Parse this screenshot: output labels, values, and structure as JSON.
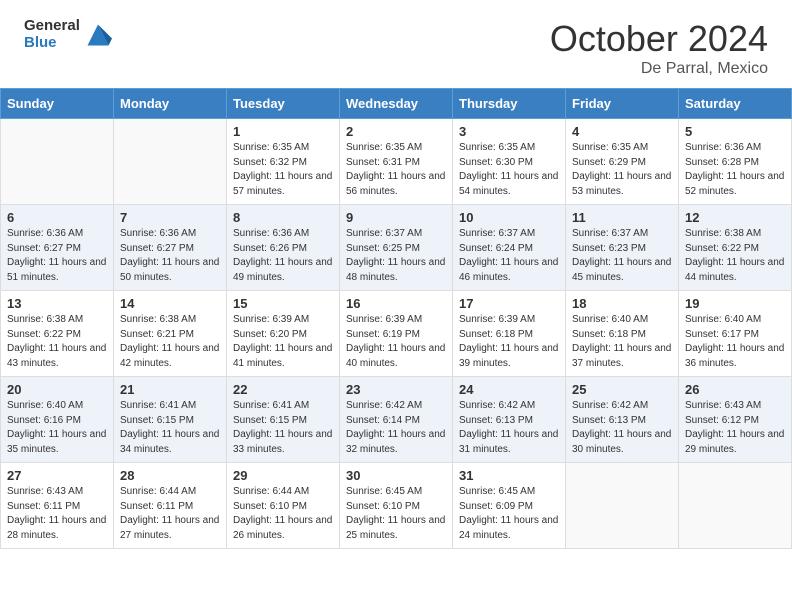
{
  "header": {
    "logo_line1": "General",
    "logo_line2": "Blue",
    "month_year": "October 2024",
    "location": "De Parral, Mexico"
  },
  "days_of_week": [
    "Sunday",
    "Monday",
    "Tuesday",
    "Wednesday",
    "Thursday",
    "Friday",
    "Saturday"
  ],
  "weeks": [
    [
      {
        "day": "",
        "info": ""
      },
      {
        "day": "",
        "info": ""
      },
      {
        "day": "1",
        "info": "Sunrise: 6:35 AM\nSunset: 6:32 PM\nDaylight: 11 hours and 57 minutes."
      },
      {
        "day": "2",
        "info": "Sunrise: 6:35 AM\nSunset: 6:31 PM\nDaylight: 11 hours and 56 minutes."
      },
      {
        "day": "3",
        "info": "Sunrise: 6:35 AM\nSunset: 6:30 PM\nDaylight: 11 hours and 54 minutes."
      },
      {
        "day": "4",
        "info": "Sunrise: 6:35 AM\nSunset: 6:29 PM\nDaylight: 11 hours and 53 minutes."
      },
      {
        "day": "5",
        "info": "Sunrise: 6:36 AM\nSunset: 6:28 PM\nDaylight: 11 hours and 52 minutes."
      }
    ],
    [
      {
        "day": "6",
        "info": "Sunrise: 6:36 AM\nSunset: 6:27 PM\nDaylight: 11 hours and 51 minutes."
      },
      {
        "day": "7",
        "info": "Sunrise: 6:36 AM\nSunset: 6:27 PM\nDaylight: 11 hours and 50 minutes."
      },
      {
        "day": "8",
        "info": "Sunrise: 6:36 AM\nSunset: 6:26 PM\nDaylight: 11 hours and 49 minutes."
      },
      {
        "day": "9",
        "info": "Sunrise: 6:37 AM\nSunset: 6:25 PM\nDaylight: 11 hours and 48 minutes."
      },
      {
        "day": "10",
        "info": "Sunrise: 6:37 AM\nSunset: 6:24 PM\nDaylight: 11 hours and 46 minutes."
      },
      {
        "day": "11",
        "info": "Sunrise: 6:37 AM\nSunset: 6:23 PM\nDaylight: 11 hours and 45 minutes."
      },
      {
        "day": "12",
        "info": "Sunrise: 6:38 AM\nSunset: 6:22 PM\nDaylight: 11 hours and 44 minutes."
      }
    ],
    [
      {
        "day": "13",
        "info": "Sunrise: 6:38 AM\nSunset: 6:22 PM\nDaylight: 11 hours and 43 minutes."
      },
      {
        "day": "14",
        "info": "Sunrise: 6:38 AM\nSunset: 6:21 PM\nDaylight: 11 hours and 42 minutes."
      },
      {
        "day": "15",
        "info": "Sunrise: 6:39 AM\nSunset: 6:20 PM\nDaylight: 11 hours and 41 minutes."
      },
      {
        "day": "16",
        "info": "Sunrise: 6:39 AM\nSunset: 6:19 PM\nDaylight: 11 hours and 40 minutes."
      },
      {
        "day": "17",
        "info": "Sunrise: 6:39 AM\nSunset: 6:18 PM\nDaylight: 11 hours and 39 minutes."
      },
      {
        "day": "18",
        "info": "Sunrise: 6:40 AM\nSunset: 6:18 PM\nDaylight: 11 hours and 37 minutes."
      },
      {
        "day": "19",
        "info": "Sunrise: 6:40 AM\nSunset: 6:17 PM\nDaylight: 11 hours and 36 minutes."
      }
    ],
    [
      {
        "day": "20",
        "info": "Sunrise: 6:40 AM\nSunset: 6:16 PM\nDaylight: 11 hours and 35 minutes."
      },
      {
        "day": "21",
        "info": "Sunrise: 6:41 AM\nSunset: 6:15 PM\nDaylight: 11 hours and 34 minutes."
      },
      {
        "day": "22",
        "info": "Sunrise: 6:41 AM\nSunset: 6:15 PM\nDaylight: 11 hours and 33 minutes."
      },
      {
        "day": "23",
        "info": "Sunrise: 6:42 AM\nSunset: 6:14 PM\nDaylight: 11 hours and 32 minutes."
      },
      {
        "day": "24",
        "info": "Sunrise: 6:42 AM\nSunset: 6:13 PM\nDaylight: 11 hours and 31 minutes."
      },
      {
        "day": "25",
        "info": "Sunrise: 6:42 AM\nSunset: 6:13 PM\nDaylight: 11 hours and 30 minutes."
      },
      {
        "day": "26",
        "info": "Sunrise: 6:43 AM\nSunset: 6:12 PM\nDaylight: 11 hours and 29 minutes."
      }
    ],
    [
      {
        "day": "27",
        "info": "Sunrise: 6:43 AM\nSunset: 6:11 PM\nDaylight: 11 hours and 28 minutes."
      },
      {
        "day": "28",
        "info": "Sunrise: 6:44 AM\nSunset: 6:11 PM\nDaylight: 11 hours and 27 minutes."
      },
      {
        "day": "29",
        "info": "Sunrise: 6:44 AM\nSunset: 6:10 PM\nDaylight: 11 hours and 26 minutes."
      },
      {
        "day": "30",
        "info": "Sunrise: 6:45 AM\nSunset: 6:10 PM\nDaylight: 11 hours and 25 minutes."
      },
      {
        "day": "31",
        "info": "Sunrise: 6:45 AM\nSunset: 6:09 PM\nDaylight: 11 hours and 24 minutes."
      },
      {
        "day": "",
        "info": ""
      },
      {
        "day": "",
        "info": ""
      }
    ]
  ]
}
